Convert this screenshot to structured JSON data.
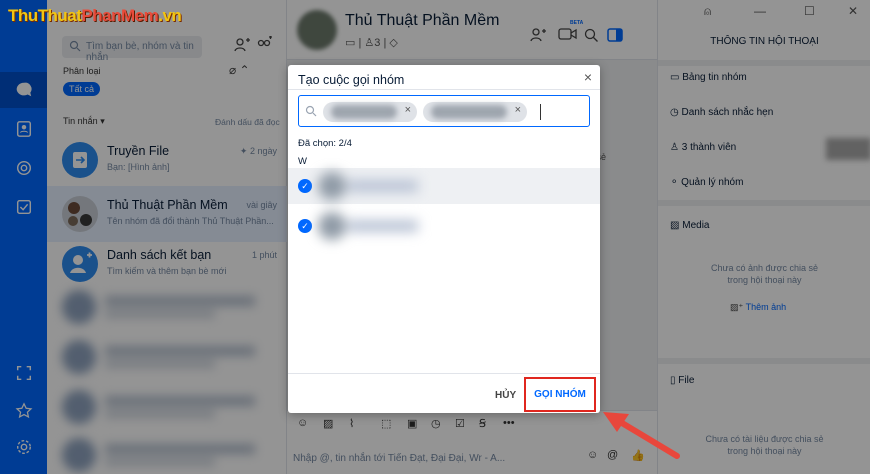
{
  "logo": {
    "part1": "ThuThuat",
    "part2": "PhanMem",
    "part3": ".vn"
  },
  "sidebar_list": {
    "search_placeholder": "Tìm bạn bè, nhóm và tin nhắn",
    "category_label": "Phân loại",
    "all_chip": "Tất cả",
    "messages_label": "Tin nhắn",
    "mark_read": "Đánh dấu đã đọc",
    "conversations": [
      {
        "title": "Truyền File",
        "sub": "Bạn: [Hình ảnh]",
        "time": "2 ngày"
      },
      {
        "title": "Thủ Thuật Phần Mềm",
        "sub": "Tên nhóm đã đổi thành Thủ Thuật Phần...",
        "time": "vài giây"
      },
      {
        "title": "Danh sách kết bạn",
        "sub": "Tìm kiếm và thêm bạn bè mới",
        "time": "1 phút"
      }
    ]
  },
  "chat": {
    "title": "Thủ Thuật Phần Mềm",
    "member_count": "3",
    "beta": "BETA",
    "input_placeholder": "Nhập @, tin nhắn tới Tiến Đạt, Đại Đại, Wr - A...",
    "partial_text": "ia sẻ"
  },
  "right_panel": {
    "title": "THÔNG TIN HỘI THOẠI",
    "items": [
      "Bảng tin nhóm",
      "Danh sách nhắc hẹn",
      "3 thành viên",
      "Quản lý nhóm"
    ],
    "media_label": "Media",
    "media_empty_line1": "Chưa có ảnh được chia sẻ",
    "media_empty_line2": "trong hội thoại này",
    "add_photo": "Thêm ảnh",
    "file_label": "File",
    "file_empty_line1": "Chưa có tài liệu được chia sẻ",
    "file_empty_line2": "trong hội thoại này"
  },
  "modal": {
    "title": "Tạo cuộc gọi nhóm",
    "selected_count": "Đã chọn: 2/4",
    "section_letter": "W",
    "cancel_label": "HỦY",
    "call_label": "GỌI NHÓM"
  },
  "colors": {
    "brand": "#0068ff",
    "highlight": "#e0271f"
  }
}
